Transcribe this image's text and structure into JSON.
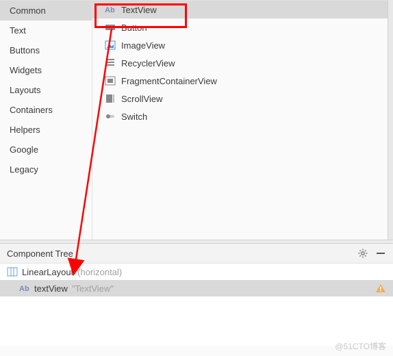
{
  "sidebar": {
    "items": [
      {
        "label": "Common"
      },
      {
        "label": "Text"
      },
      {
        "label": "Buttons"
      },
      {
        "label": "Widgets"
      },
      {
        "label": "Layouts"
      },
      {
        "label": "Containers"
      },
      {
        "label": "Helpers"
      },
      {
        "label": "Google"
      },
      {
        "label": "Legacy"
      }
    ]
  },
  "palette": {
    "items": [
      {
        "label": "TextView",
        "icon": "textview"
      },
      {
        "label": "Button",
        "icon": "button"
      },
      {
        "label": "ImageView",
        "icon": "imageview"
      },
      {
        "label": "RecyclerView",
        "icon": "recyclerview"
      },
      {
        "label": "FragmentContainerView",
        "icon": "fragmentcontainer"
      },
      {
        "label": "ScrollView",
        "icon": "scrollview"
      },
      {
        "label": "Switch",
        "icon": "switch"
      }
    ]
  },
  "component_tree": {
    "title": "Component Tree",
    "root": {
      "label": "LinearLayout",
      "qualifier": "(horizontal)"
    },
    "child": {
      "label": "textView",
      "qualifier": "\"TextView\""
    }
  },
  "watermark": "@51CTO博客"
}
